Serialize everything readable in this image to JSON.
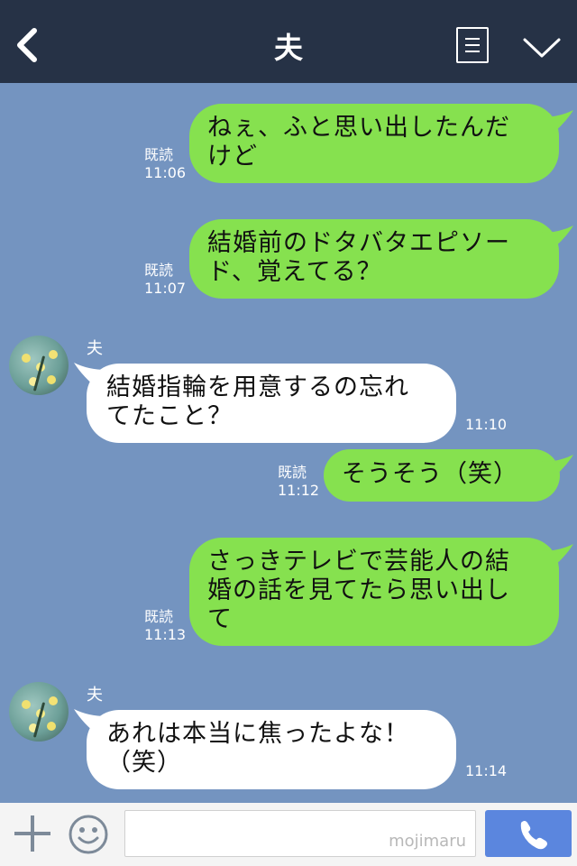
{
  "header": {
    "title": "夫"
  },
  "messages": [
    {
      "dir": "out",
      "lines": [
        "ねぇ、ふと思い出したんだ",
        "けど"
      ],
      "read": "既読",
      "time": "11:06"
    },
    {
      "dir": "out",
      "lines": [
        "結婚前のドタバタエピソー",
        "ド、覚えてる？"
      ],
      "read": "既読",
      "time": "11:07"
    },
    {
      "dir": "in",
      "sender": "夫",
      "lines": [
        "結婚指輪を用意するの忘れ",
        "てたこと？"
      ],
      "time": "11:10"
    },
    {
      "dir": "out",
      "lines": [
        "そうそう（笑）"
      ],
      "read": "既読",
      "time": "11:12"
    },
    {
      "dir": "out",
      "lines": [
        "さっきテレビで芸能人の結",
        "婚の話を見てたら思い出し",
        "て"
      ],
      "read": "既読",
      "time": "11:13"
    },
    {
      "dir": "in",
      "sender": "夫",
      "lines": [
        "あれは本当に焦ったよな！",
        "（笑）"
      ],
      "time": "11:14"
    }
  ],
  "footer": {
    "watermark": "mojimaru",
    "input_placeholder": ""
  },
  "colors": {
    "header_bg": "#263246",
    "chat_bg": "#7494c0",
    "out_bubble": "#86e14f",
    "in_bubble": "#ffffff",
    "call_button": "#5b86de"
  },
  "icons": {
    "back": "chevron-left-icon",
    "menu": "list-icon",
    "collapse": "chevron-down-icon",
    "add": "plus-icon",
    "emoji": "smiley-icon",
    "call": "phone-icon"
  }
}
